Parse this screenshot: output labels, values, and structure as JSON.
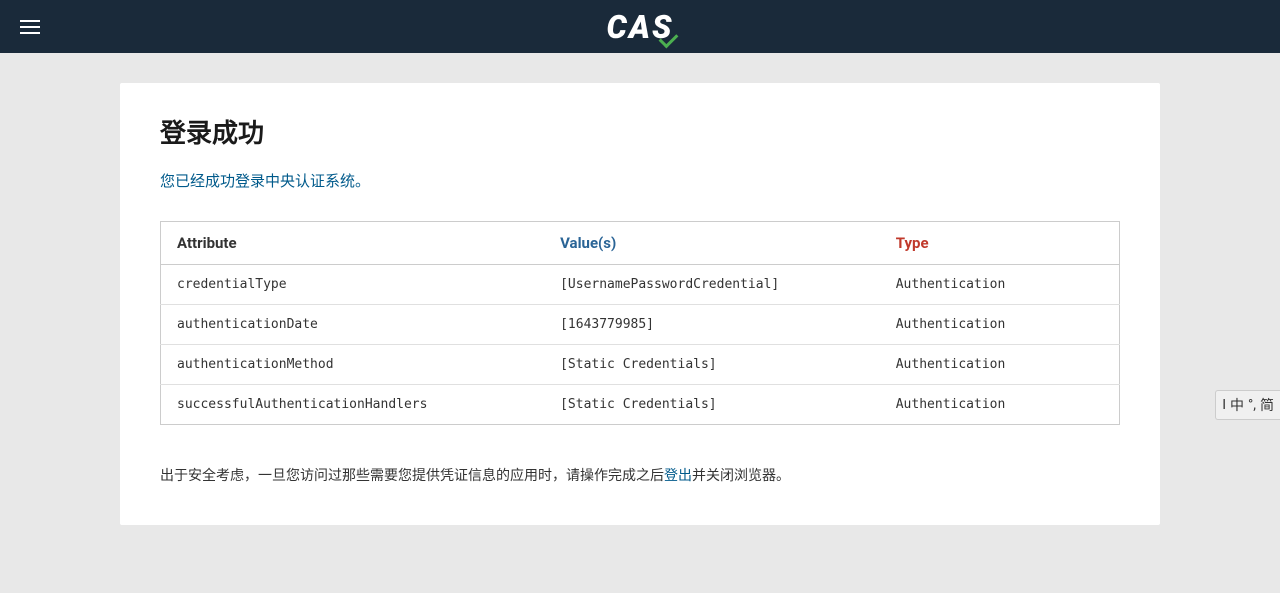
{
  "header": {
    "logo_text": "CAS",
    "menu_icon_label": "menu"
  },
  "page": {
    "title": "登录成功",
    "success_message": "您已经成功登录中央认证系统。",
    "table": {
      "columns": [
        {
          "key": "attribute",
          "label": "Attribute",
          "class": "col-attribute"
        },
        {
          "key": "values",
          "label": "Value(s)",
          "class": "col-values"
        },
        {
          "key": "type",
          "label": "Type",
          "class": "col-type"
        }
      ],
      "rows": [
        {
          "attribute": "credentialType",
          "values": "[UsernamePasswordCredential]",
          "type": "Authentication"
        },
        {
          "attribute": "authenticationDate",
          "values": "[1643779985]",
          "type": "Authentication"
        },
        {
          "attribute": "authenticationMethod",
          "values": "[Static Credentials]",
          "type": "Authentication"
        },
        {
          "attribute": "successfulAuthenticationHandlers",
          "values": "[Static Credentials]",
          "type": "Authentication"
        }
      ]
    },
    "footer_note_before_link": "出于安全考虑，一旦您访问过那些需要您提供凭证信息的应用时，请操作完成之后",
    "footer_note_link": "登出",
    "footer_note_after_link": "并关闭浏览器。"
  },
  "ime_toolbar": {
    "items": [
      "I",
      "中",
      "°,",
      "简"
    ]
  }
}
